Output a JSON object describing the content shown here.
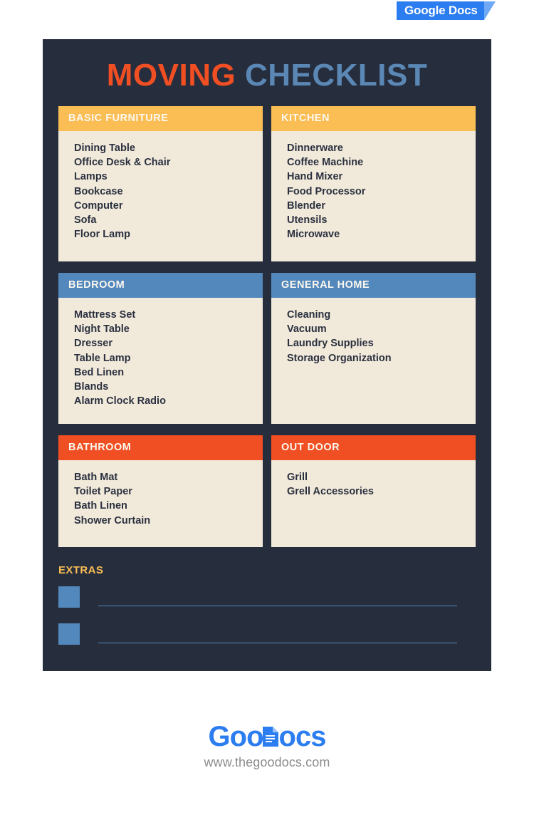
{
  "badge": {
    "label": "Google Docs"
  },
  "title": {
    "word1": "MOVING",
    "word2": "CHECKLIST",
    "color1": "#F04E23",
    "color2": "#5B87B5"
  },
  "sections": [
    {
      "key": "basic-furniture",
      "heading": "BASIC FURNITURE",
      "accent": "#FBBE54",
      "items": [
        "Dining Table",
        "Office Desk & Chair",
        "Lamps",
        "Bookcase",
        "Computer",
        "Sofa",
        "Floor Lamp"
      ]
    },
    {
      "key": "kitchen",
      "heading": "KITCHEN",
      "accent": "#FBBE54",
      "items": [
        "Dinnerware",
        "Coffee Machine",
        "Hand Mixer",
        "Food Processor",
        "Blender",
        "Utensils",
        "Microwave"
      ]
    },
    {
      "key": "bedroom",
      "heading": "BEDROOM",
      "accent": "#5388BC",
      "items": [
        "Mattress Set",
        "Night Table",
        "Dresser",
        "Table Lamp",
        "Bed Linen",
        "Blands",
        "Alarm Clock Radio"
      ]
    },
    {
      "key": "general-home",
      "heading": "GENERAL HOME",
      "accent": "#5388BC",
      "items": [
        "Cleaning",
        "Vacuum",
        "Laundry Supplies",
        "Storage Organization"
      ]
    },
    {
      "key": "bathroom",
      "heading": "BATHROOM",
      "accent": "#F04E23",
      "items": [
        "Bath Mat",
        "Toilet Paper",
        "Bath Linen",
        "Shower Curtain"
      ]
    },
    {
      "key": "out-door",
      "heading": "OUT DOOR",
      "accent": "#F04E23",
      "items": [
        "Grill",
        "Grell Accessories"
      ]
    }
  ],
  "extras": {
    "title": "EXTRAS",
    "rows": [
      {
        "value": ""
      },
      {
        "value": ""
      }
    ]
  },
  "footer": {
    "logo_part1": "Goo",
    "logo_part2": "ocs",
    "url": "www.thegoodocs.com"
  },
  "colors": {
    "frame_bg": "#262D3D",
    "card_bg": "#F1EADA",
    "text_dark": "#2B3040",
    "head_text": "#FBF7EE",
    "yellow": "#FBBE54",
    "blue": "#5388BC",
    "red": "#F04E23",
    "logo_blue": "#2B7DF0",
    "url_gray": "#8C8C8C"
  }
}
